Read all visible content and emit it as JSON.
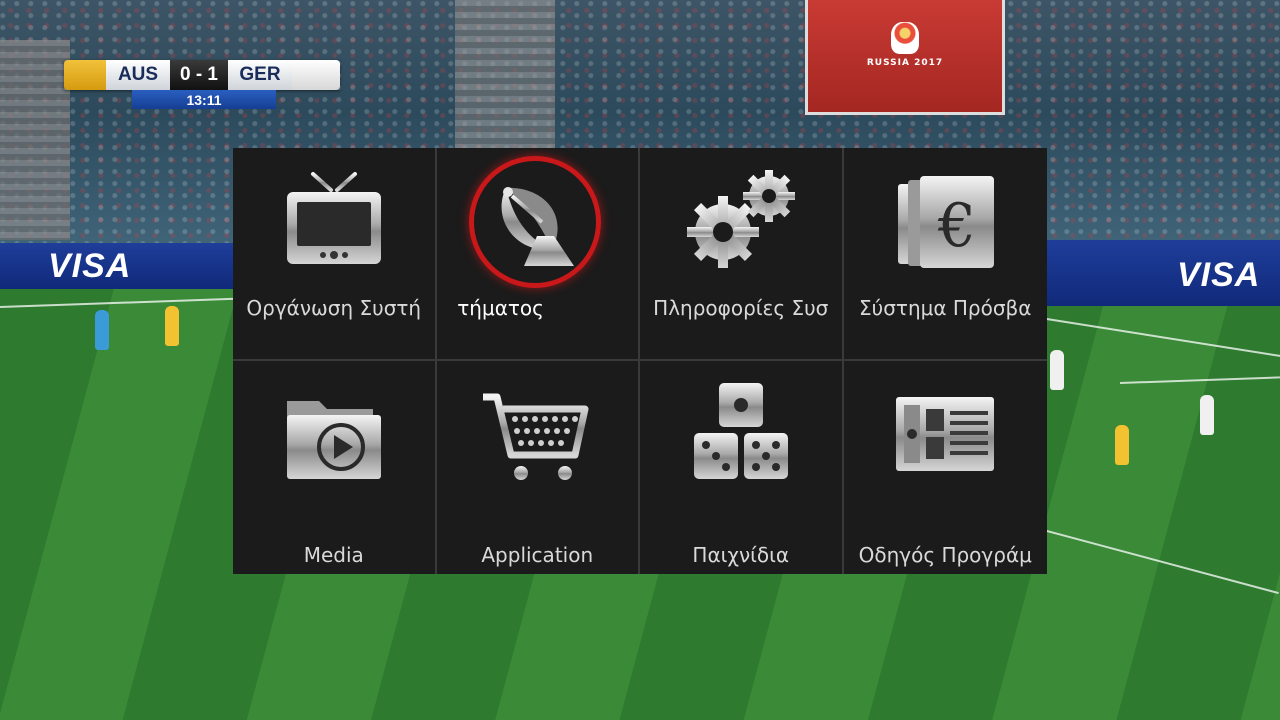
{
  "broadcast": {
    "scoreboard": {
      "home": "AUS",
      "score": "0 - 1",
      "away": "GER",
      "clock": "13:11"
    },
    "stadium_screen": "RUSSIA 2017",
    "adboards": [
      "VISA",
      "VISA"
    ]
  },
  "menu": {
    "items": [
      {
        "label": "Οργάνωση Συστή",
        "icon": "tv-icon"
      },
      {
        "label": "τήματος",
        "icon": "satellite-dish-icon",
        "selected": true
      },
      {
        "label": "Πληροφορίες Συσ",
        "icon": "gears-icon"
      },
      {
        "label": "Σύστημα Πρόσβα",
        "icon": "euro-cards-icon"
      },
      {
        "label": "Media",
        "icon": "media-folder-icon"
      },
      {
        "label": "Application",
        "icon": "shopping-cart-icon"
      },
      {
        "label": "Παιχνίδια",
        "icon": "dice-icon"
      },
      {
        "label": "Οδηγός Προγράμ",
        "icon": "program-guide-icon"
      }
    ]
  },
  "colors": {
    "menu_bg": "#1b1b1b",
    "selection_ring": "#c8181a",
    "label": "#d9d9d9"
  }
}
